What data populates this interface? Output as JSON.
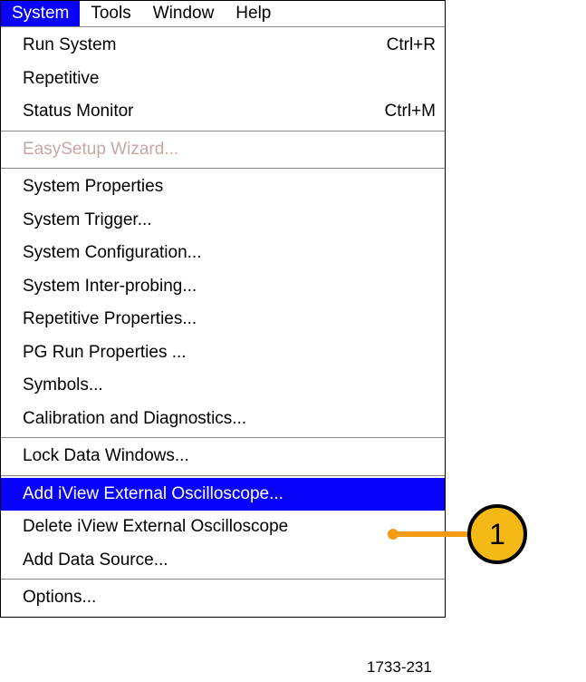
{
  "menubar": {
    "items": [
      {
        "label": "System",
        "active": true
      },
      {
        "label": "Tools",
        "active": false
      },
      {
        "label": "Window",
        "active": false
      },
      {
        "label": "Help",
        "active": false
      }
    ]
  },
  "menu": {
    "sections": [
      {
        "items": [
          {
            "label": "Run System",
            "shortcut": "Ctrl+R",
            "disabled": false,
            "highlighted": false
          },
          {
            "label": "Repetitive",
            "shortcut": "",
            "disabled": false,
            "highlighted": false
          },
          {
            "label": "Status Monitor",
            "shortcut": "Ctrl+M",
            "disabled": false,
            "highlighted": false
          }
        ]
      },
      {
        "items": [
          {
            "label": "EasySetup Wizard...",
            "shortcut": "",
            "disabled": true,
            "highlighted": false
          }
        ]
      },
      {
        "items": [
          {
            "label": "System Properties",
            "shortcut": "",
            "disabled": false,
            "highlighted": false
          },
          {
            "label": "System Trigger...",
            "shortcut": "",
            "disabled": false,
            "highlighted": false
          },
          {
            "label": "System Configuration...",
            "shortcut": "",
            "disabled": false,
            "highlighted": false
          },
          {
            "label": "System Inter-probing...",
            "shortcut": "",
            "disabled": false,
            "highlighted": false
          },
          {
            "label": "Repetitive Properties...",
            "shortcut": "",
            "disabled": false,
            "highlighted": false
          },
          {
            "label": "PG Run Properties ...",
            "shortcut": "",
            "disabled": false,
            "highlighted": false
          },
          {
            "label": "Symbols...",
            "shortcut": "",
            "disabled": false,
            "highlighted": false
          },
          {
            "label": "Calibration and Diagnostics...",
            "shortcut": "",
            "disabled": false,
            "highlighted": false
          }
        ]
      },
      {
        "items": [
          {
            "label": "Lock Data Windows...",
            "shortcut": "",
            "disabled": false,
            "highlighted": false
          }
        ]
      },
      {
        "items": [
          {
            "label": "Add iView External Oscilloscope...",
            "shortcut": "",
            "disabled": false,
            "highlighted": true
          },
          {
            "label": "Delete iView External Oscilloscope",
            "shortcut": "",
            "disabled": false,
            "highlighted": false
          },
          {
            "label": "Add Data Source...",
            "shortcut": "",
            "disabled": false,
            "highlighted": false
          }
        ]
      },
      {
        "items": [
          {
            "label": "Options...",
            "shortcut": "",
            "disabled": false,
            "highlighted": false
          }
        ]
      }
    ]
  },
  "callout": {
    "number": "1"
  },
  "image_id": "1733-231"
}
